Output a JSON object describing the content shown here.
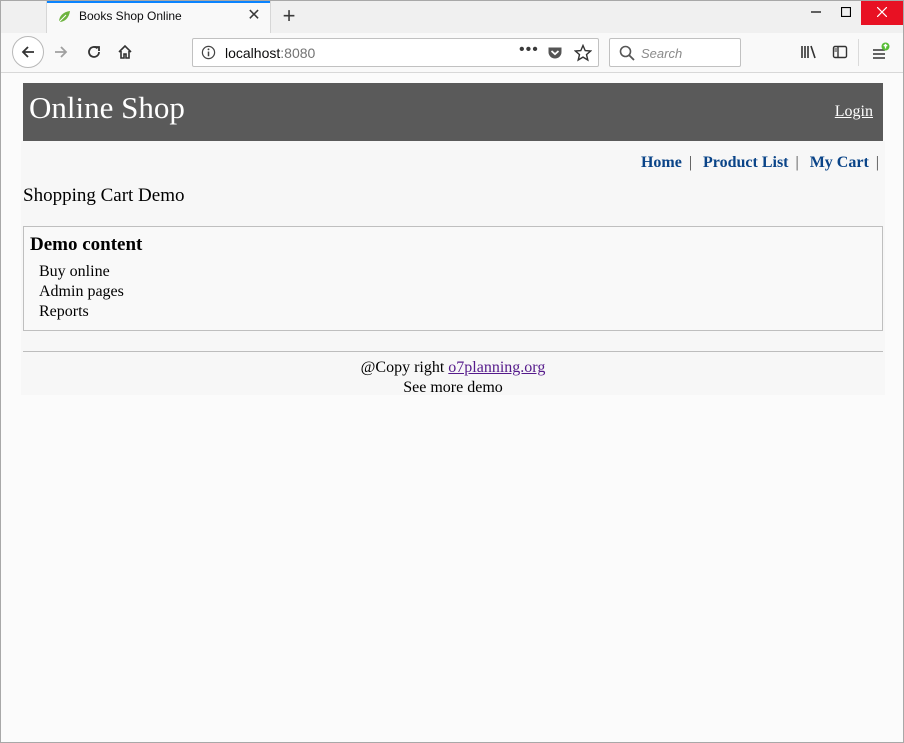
{
  "browser": {
    "tab_title": "Books Shop Online",
    "url_host": "localhost",
    "url_port": ":8080",
    "search_placeholder": "Search",
    "accent_color": "#0a84ff",
    "icons": {
      "favicon": "leaf-icon",
      "tab_close": "close-icon",
      "new_tab": "plus-icon",
      "back": "arrow-left-icon",
      "forward": "arrow-right-icon",
      "reload": "reload-icon",
      "home": "home-icon",
      "site_info": "info-icon",
      "page_actions": "ellipsis-icon",
      "pocket": "pocket-icon",
      "bookmark": "star-icon",
      "search": "search-icon",
      "library": "library-icon",
      "sidebar": "sidebar-icon",
      "menu": "hamburger-icon"
    }
  },
  "page": {
    "brand": "Online Shop",
    "login": "Login",
    "banner_color": "#5a5a5a",
    "nav": [
      {
        "label": "Home"
      },
      {
        "label": "Product List"
      },
      {
        "label": "My Cart"
      }
    ],
    "nav_separator": "|",
    "subtitle": "Shopping Cart Demo",
    "demo": {
      "title": "Demo content",
      "items": [
        "Buy online",
        "Admin pages",
        "Reports"
      ]
    },
    "footer": {
      "copyright_prefix": "@Copy right",
      "copyright_link": "o7planning.org",
      "more": "See more demo"
    }
  }
}
